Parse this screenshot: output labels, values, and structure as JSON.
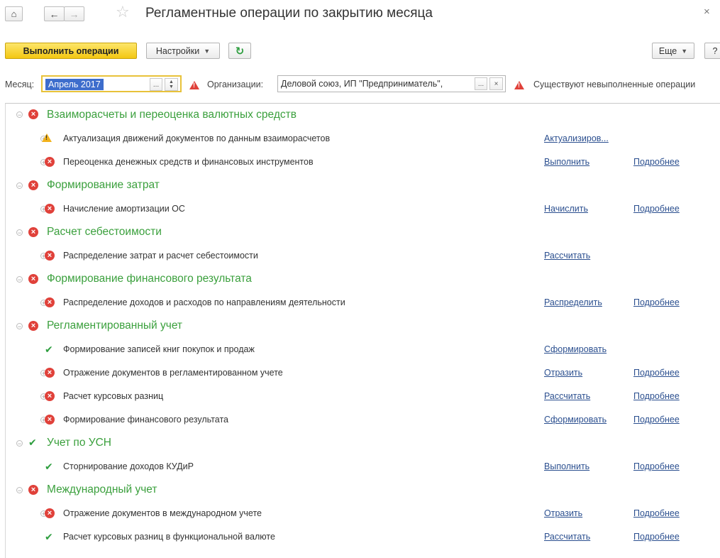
{
  "window": {
    "title": "Регламентные операции по закрытию месяца",
    "close_glyph": "×"
  },
  "toolbar": {
    "run_label": "Выполнить операции",
    "settings_label": "Настройки",
    "more_label": "Еще",
    "help_label": "?"
  },
  "filter": {
    "month_label": "Месяц:",
    "month_value": "Апрель 2017",
    "org_label": "Организации:",
    "org_value": "Деловой союз, ИП \"Предприниматель\", ",
    "status_text": "Существуют невыполненные операции"
  },
  "groups": {
    "g1": {
      "title": "Взаиморасчеты и переоценка валютных средств",
      "status": "error",
      "items": [
        {
          "title": "Актуализация движений документов по данным взаиморасчетов",
          "status": "warning",
          "action": "Актуализиров...",
          "details": ""
        },
        {
          "title": "Переоценка денежных средств и финансовых инструментов",
          "status": "error",
          "action": "Выполнить",
          "details": "Подробнее"
        }
      ]
    },
    "g2": {
      "title": "Формирование затрат",
      "status": "error",
      "items": [
        {
          "title": "Начисление амортизации ОС",
          "status": "error",
          "action": "Начислить",
          "details": "Подробнее"
        }
      ]
    },
    "g3": {
      "title": "Расчет себестоимости",
      "status": "error",
      "items": [
        {
          "title": "Распределение затрат и расчет себестоимости",
          "status": "error",
          "action": "Рассчитать",
          "details": ""
        }
      ]
    },
    "g4": {
      "title": "Формирование финансового результата",
      "status": "error",
      "items": [
        {
          "title": "Распределение доходов и расходов по направлениям деятельности",
          "status": "error",
          "action": "Распределить",
          "details": "Подробнее"
        }
      ]
    },
    "g5": {
      "title": "Регламентированный учет",
      "status": "error",
      "items": [
        {
          "title": "Формирование записей книг покупок и продаж",
          "status": "ok",
          "action": "Сформировать",
          "details": ""
        },
        {
          "title": "Отражение документов в регламентированном учете",
          "status": "error",
          "action": "Отразить",
          "details": "Подробнее"
        },
        {
          "title": "Расчет курсовых разниц",
          "status": "error",
          "action": "Рассчитать",
          "details": "Подробнее"
        },
        {
          "title": "Формирование финансового результата",
          "status": "error",
          "action": "Сформировать",
          "details": "Подробнее"
        }
      ]
    },
    "g6": {
      "title": "Учет по УСН",
      "status": "ok",
      "items": [
        {
          "title": "Сторнирование доходов КУДиР",
          "status": "ok",
          "action": "Выполнить",
          "details": "Подробнее"
        }
      ]
    },
    "g7": {
      "title": "Международный учет",
      "status": "error",
      "items": [
        {
          "title": "Отражение документов в международном учете",
          "status": "error",
          "action": "Отразить",
          "details": "Подробнее"
        },
        {
          "title": "Расчет курсовых разниц в функциональной валюте",
          "status": "ok",
          "action": "Рассчитать",
          "details": "Подробнее"
        }
      ]
    }
  }
}
